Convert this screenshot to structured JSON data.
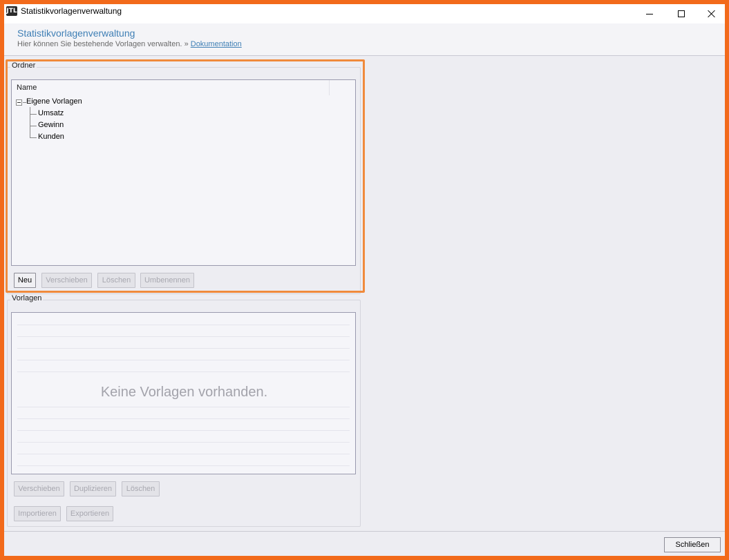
{
  "window": {
    "title": "Statistikvorlagenverwaltung",
    "icon_text": "JTL"
  },
  "header": {
    "title": "Statistikvorlagenverwaltung",
    "subtitle": "Hier können Sie bestehende Vorlagen verwalten.",
    "link_prefix": "»",
    "link_text": "Dokumentation"
  },
  "folders": {
    "group_label": "Ordner",
    "column_header": "Name",
    "root": "Eigene Vorlagen",
    "children": [
      "Umsatz",
      "Gewinn",
      "Kunden"
    ],
    "buttons": {
      "new": "Neu",
      "move": "Verschieben",
      "delete": "Löschen",
      "rename": "Umbenennen"
    }
  },
  "templates": {
    "group_label": "Vorlagen",
    "empty_message": "Keine Vorlagen vorhanden.",
    "buttons": {
      "move": "Verschieben",
      "duplicate": "Duplizieren",
      "delete": "Löschen",
      "import": "Importieren",
      "export": "Exportieren"
    }
  },
  "footer": {
    "close_label": "Schließen"
  },
  "colors": {
    "accent_orange": "#f26a1b",
    "highlight_orange": "#f08a3c",
    "link_blue": "#3f7fb5"
  }
}
